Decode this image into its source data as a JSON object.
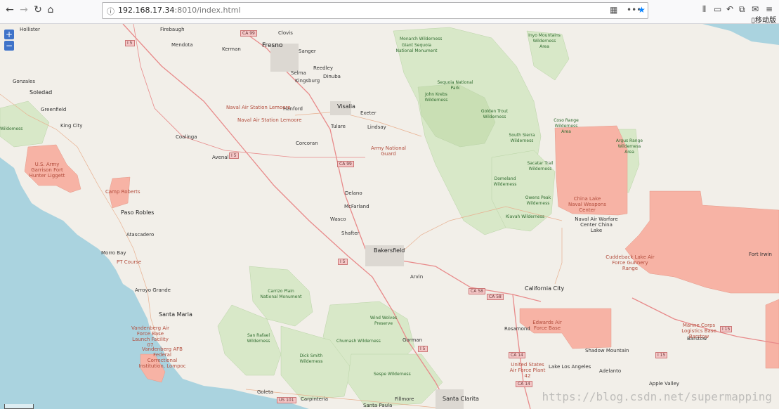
{
  "browser": {
    "url_host": "192.168.17.34",
    "url_rest": ":8010/index.html",
    "mobile_bookmarks": "移动版"
  },
  "map_controls": {
    "zoom_in": "+",
    "zoom_out": "−"
  },
  "watermark": "https://blog.csdn.net/supermapping",
  "colors": {
    "land": "#f2efe9",
    "water": "#aad3df",
    "military": "#f7b3a5",
    "park": "#d8e8c8",
    "road_major": "#e88a8a"
  },
  "places": [
    {
      "name": "Hollister",
      "kind": "town"
    },
    {
      "name": "Firebaugh",
      "kind": "town"
    },
    {
      "name": "Clovis",
      "kind": "town"
    },
    {
      "name": "Mendota",
      "kind": "town"
    },
    {
      "name": "Kerman",
      "kind": "town"
    },
    {
      "name": "Fresno",
      "kind": "city"
    },
    {
      "name": "Sanger",
      "kind": "town"
    },
    {
      "name": "Reedley",
      "kind": "town"
    },
    {
      "name": "Selma",
      "kind": "town"
    },
    {
      "name": "Dinuba",
      "kind": "town"
    },
    {
      "name": "Kingsburg",
      "kind": "town"
    },
    {
      "name": "Gonzales",
      "kind": "town"
    },
    {
      "name": "Soledad",
      "kind": "big"
    },
    {
      "name": "Greenfield",
      "kind": "town"
    },
    {
      "name": "King City",
      "kind": "town"
    },
    {
      "name": "Coalinga",
      "kind": "town"
    },
    {
      "name": "Hanford",
      "kind": "town"
    },
    {
      "name": "Visalia",
      "kind": "big"
    },
    {
      "name": "Exeter",
      "kind": "town"
    },
    {
      "name": "Tulare",
      "kind": "town"
    },
    {
      "name": "Lindsay",
      "kind": "town"
    },
    {
      "name": "Corcoran",
      "kind": "town"
    },
    {
      "name": "Avenal",
      "kind": "town"
    },
    {
      "name": "Delano",
      "kind": "town"
    },
    {
      "name": "McFarland",
      "kind": "town"
    },
    {
      "name": "Wasco",
      "kind": "town"
    },
    {
      "name": "Shafter",
      "kind": "town"
    },
    {
      "name": "Bakersfield",
      "kind": "big"
    },
    {
      "name": "Arvin",
      "kind": "town"
    },
    {
      "name": "Paso Robles",
      "kind": "big"
    },
    {
      "name": "Atascadero",
      "kind": "town"
    },
    {
      "name": "Morro Bay",
      "kind": "town"
    },
    {
      "name": "Arroyo Grande",
      "kind": "town"
    },
    {
      "name": "Santa Maria",
      "kind": "big"
    },
    {
      "name": "Goleta",
      "kind": "town"
    },
    {
      "name": "Carpinteria",
      "kind": "town"
    },
    {
      "name": "Santa Paula",
      "kind": "town"
    },
    {
      "name": "Fillmore",
      "kind": "town"
    },
    {
      "name": "Santa Clarita",
      "kind": "big"
    },
    {
      "name": "Gorman",
      "kind": "town"
    },
    {
      "name": "California City",
      "kind": "big"
    },
    {
      "name": "Rosamond",
      "kind": "town"
    },
    {
      "name": "Lake Los Angeles",
      "kind": "town"
    },
    {
      "name": "Shadow Mountain",
      "kind": "town"
    },
    {
      "name": "Adelanto",
      "kind": "town"
    },
    {
      "name": "Apple Valley",
      "kind": "town"
    },
    {
      "name": "Barstow",
      "kind": "town"
    },
    {
      "name": "Fort Irwin",
      "kind": "town"
    },
    {
      "name": "Wildomess",
      "kind": "park"
    }
  ],
  "military": [
    {
      "name": "Naval Air Station Lemoore"
    },
    {
      "name": "Naval Air Station Lemoore"
    },
    {
      "name": "Army National Guard"
    },
    {
      "name": "U.S. Army Garrison Fort Hunter Liggett"
    },
    {
      "name": "Camp Roberts"
    },
    {
      "name": "PT Course"
    },
    {
      "name": "Vandenberg Air Force Base Launch Facility 07"
    },
    {
      "name": "Vandenberg AFB Federal Correctional Institution, Lompoc"
    },
    {
      "name": "China Lake Naval Weapons Center"
    },
    {
      "name": "Naval Air Warfare Center China Lake"
    },
    {
      "name": "Cuddeback Lake Air Force Gunnery Range"
    },
    {
      "name": "Edwards Air Force Base"
    },
    {
      "name": "United States Air Force Plant 42"
    },
    {
      "name": "Marine Corps Logistics Base Barstow"
    }
  ],
  "parks": [
    {
      "name": "Monarch Wilderness"
    },
    {
      "name": "Giant Sequoia National Monument"
    },
    {
      "name": "Sequoia National Park"
    },
    {
      "name": "John Krebs Wilderness"
    },
    {
      "name": "Golden Trout Wilderness"
    },
    {
      "name": "Inyo Mountains Wilderness Area"
    },
    {
      "name": "Coso Range Wilderness Area"
    },
    {
      "name": "Argus Range Wilderness Area"
    },
    {
      "name": "South Sierra Wilderness"
    },
    {
      "name": "Sacatar Trail Wilderness"
    },
    {
      "name": "Domeland Wilderness"
    },
    {
      "name": "Owens Peak Wilderness"
    },
    {
      "name": "Kiavah Wilderness"
    },
    {
      "name": "Carrizo Plain National Monument"
    },
    {
      "name": "Wind Wolves Preserve"
    },
    {
      "name": "San Rafael Wilderness"
    },
    {
      "name": "Chumash Wilderness"
    },
    {
      "name": "Dick Smith Wilderness"
    },
    {
      "name": "Sespe Wilderness"
    }
  ],
  "shields": [
    "CA 99",
    "I 5",
    "I 5",
    "CA 99",
    "I 5",
    "CA 58",
    "CA 58",
    "CA 14",
    "CA 14",
    "I 15",
    "I 15",
    "US 101",
    "I 5"
  ]
}
